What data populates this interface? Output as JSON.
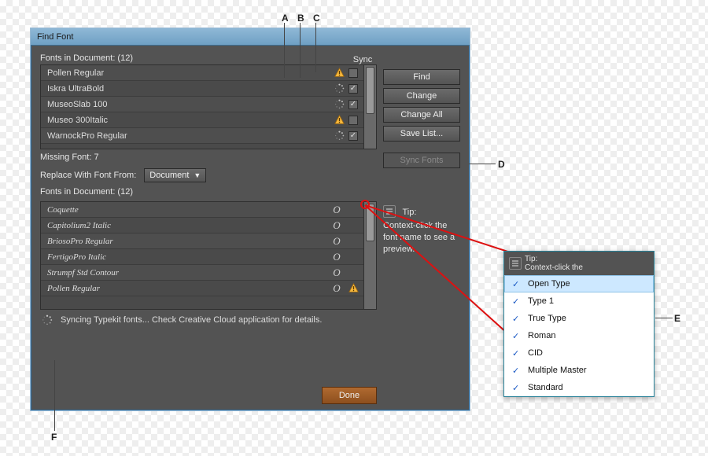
{
  "window": {
    "title": "Find Font"
  },
  "labels": {
    "fonts_in_doc": "Fonts in Document: (12)",
    "sync": "Sync",
    "missing": "Missing Font: 7",
    "replace_with": "Replace With Font From:",
    "replace_dropdown": "Document",
    "fonts_in_doc2": "Fonts in Document: (12)",
    "status": "Syncing Typekit fonts... Check Creative Cloud application for details.",
    "tip_title": "Tip:",
    "tip_body": "Context-click the font name to see a preview."
  },
  "buttons": {
    "find": "Find",
    "change": "Change",
    "change_all": "Change All",
    "save_list": "Save List...",
    "sync_fonts": "Sync Fonts",
    "done": "Done"
  },
  "top_list": [
    {
      "name": "Pollen Regular",
      "status": "warn",
      "sync": "unchecked"
    },
    {
      "name": "Iskra UltraBold",
      "status": "spin",
      "sync": "checked"
    },
    {
      "name": "MuseoSlab 100",
      "status": "spin",
      "sync": "checked"
    },
    {
      "name": "Museo 300Italic",
      "status": "warn",
      "sync": "unchecked"
    },
    {
      "name": "WarnockPro Regular",
      "status": "spin",
      "sync": "checked"
    }
  ],
  "bottom_list": [
    {
      "name": "Coquette",
      "status": ""
    },
    {
      "name": "Capitolium2 Italic",
      "status": ""
    },
    {
      "name": "BriosoPro Regular",
      "status": ""
    },
    {
      "name": "FertigoPro Italic",
      "status": ""
    },
    {
      "name": "Strumpf Std Contour",
      "status": ""
    },
    {
      "name": "Pollen Regular",
      "status": "warn"
    }
  ],
  "popup": {
    "head": "Tip:\nContext-click the",
    "items": [
      "Open Type",
      "Type 1",
      "True Type",
      "Roman",
      "CID",
      "Multiple Master",
      "Standard"
    ]
  },
  "callouts": {
    "a": "A",
    "b": "B",
    "c": "C",
    "d": "D",
    "e": "E",
    "f": "F"
  }
}
